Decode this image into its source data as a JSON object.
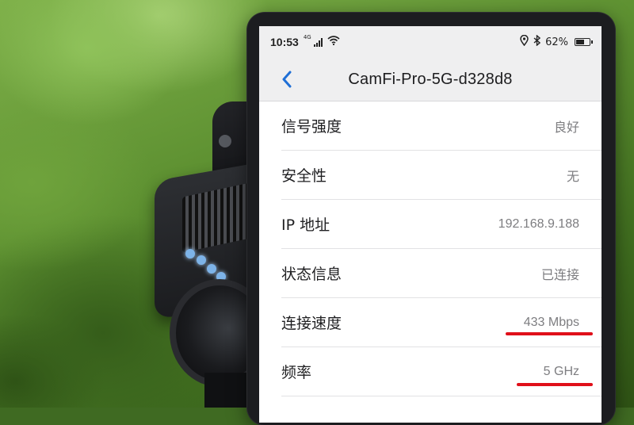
{
  "status_bar": {
    "time": "10:53",
    "network_type": "4G",
    "signal_icon": "signal-bars-icon",
    "wifi_icon": "wifi-icon",
    "location_icon": "location-pin-icon",
    "bluetooth_icon": "bluetooth-icon",
    "battery_percent": "62%",
    "battery_level": 0.62
  },
  "header": {
    "back_icon": "chevron-left-icon",
    "title": "CamFi-Pro-5G-d328d8"
  },
  "details": [
    {
      "label": "信号强度",
      "value": "良好",
      "highlighted": false
    },
    {
      "label": "安全性",
      "value": "无",
      "highlighted": false
    },
    {
      "label": "IP 地址",
      "value": "192.168.9.188",
      "highlighted": false
    },
    {
      "label": "状态信息",
      "value": "已连接",
      "highlighted": false
    },
    {
      "label": "连接速度",
      "value": "433 Mbps",
      "highlighted": true
    },
    {
      "label": "频率",
      "value": "5 GHz",
      "highlighted": true
    }
  ],
  "colors": {
    "accent": "#1f6fd6",
    "highlight_underline": "#e0101a",
    "header_bg": "#efeff0"
  }
}
